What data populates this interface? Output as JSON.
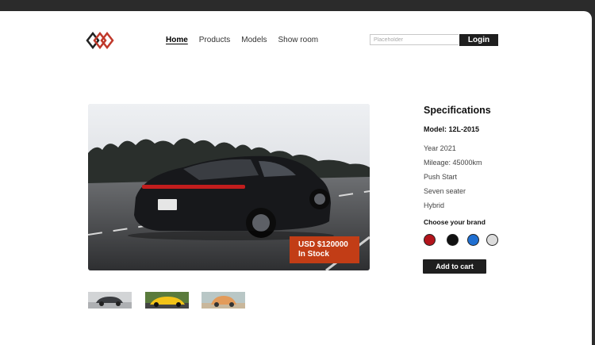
{
  "header": {
    "nav": [
      {
        "label": "Home",
        "active": true
      },
      {
        "label": "Products",
        "active": false
      },
      {
        "label": "Models",
        "active": false
      },
      {
        "label": "Show room",
        "active": false
      }
    ],
    "search_placeholder": "Placeholder",
    "login_label": "Login",
    "logo_colors": [
      "#222222",
      "#c0392b"
    ]
  },
  "hero": {
    "price": "USD $120000",
    "stock": "In Stock",
    "badge_color": "#c23d16"
  },
  "thumbnails": [
    {
      "name": "thumbnail-grey-car"
    },
    {
      "name": "thumbnail-yellow-car"
    },
    {
      "name": "thumbnail-orange-car"
    }
  ],
  "specs": {
    "title": "Specifications",
    "model": "Model: 12L-2015",
    "items": [
      "Year 2021",
      "Mileage: 45000km",
      "Push Start",
      "Seven seater",
      "Hybrid"
    ],
    "brand_label": "Choose your brand",
    "colors": [
      {
        "name": "red",
        "hex": "#b3141b"
      },
      {
        "name": "black",
        "hex": "#111111"
      },
      {
        "name": "blue",
        "hex": "#1f6fd1"
      },
      {
        "name": "light-grey",
        "hex": "#dcdcdc"
      }
    ],
    "cart_label": "Add to cart"
  }
}
